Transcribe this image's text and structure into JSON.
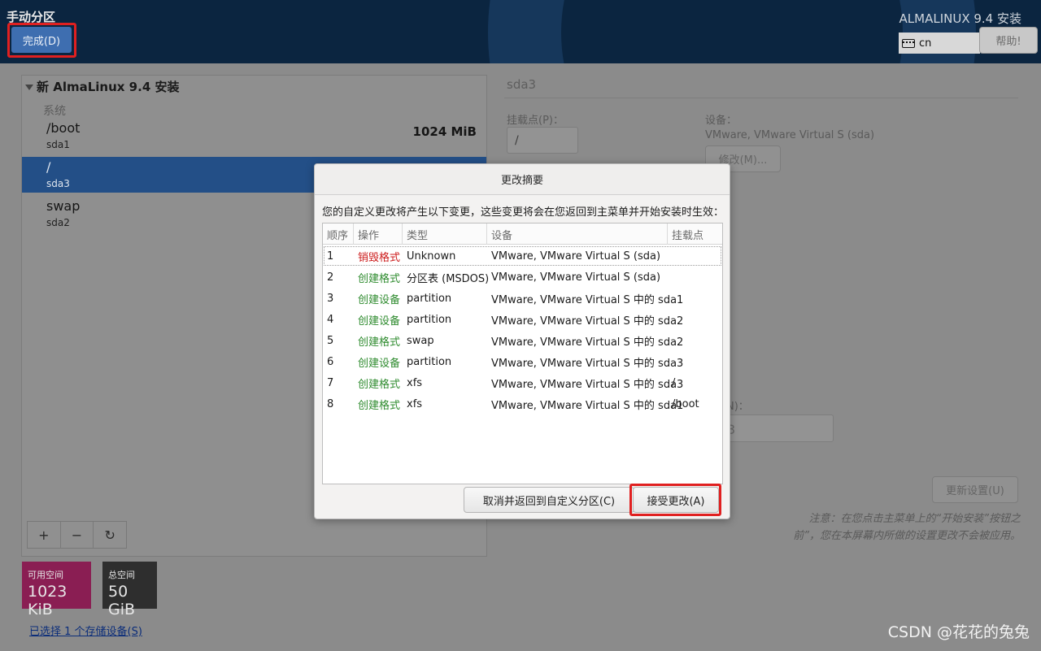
{
  "header": {
    "title": "手动分区",
    "done_label": "完成(D)",
    "product": "ALMALINUX 9.4 安装",
    "keyboard_layout": "cn",
    "help_label": "帮助!"
  },
  "left_panel": {
    "install_title": "新 AlmaLinux 9.4 安装",
    "section": "系统",
    "mounts": [
      {
        "name": "/boot",
        "device": "sda1",
        "size": "1024 MiB",
        "selected": false
      },
      {
        "name": "/",
        "device": "sda3",
        "size": "",
        "selected": true
      },
      {
        "name": "swap",
        "device": "sda2",
        "size": "",
        "selected": false
      }
    ],
    "tools": [
      "+",
      "−",
      "↻"
    ]
  },
  "space": {
    "available_label": "可用空间",
    "available_value": "1023 KiB",
    "total_label": "总空间",
    "total_value": "50 GiB"
  },
  "storage_link": "已选择 1 个存储设备(S)",
  "right_panel": {
    "title": "sda3",
    "mount_label": "挂载点(P)：",
    "mount_value": "/",
    "device_label": "设备：",
    "device_value": "VMware, VMware Virtual S (sda)",
    "modify_label": "修改(M)...",
    "partial_label": "N)：",
    "partial_value": "3",
    "update_label": "更新设置(U)",
    "note": "注意：在您点击主菜单上的“开始安装”按钮之前”，您在本屏幕内所做的设置更改不会被应用。"
  },
  "dialog": {
    "title": "更改摘要",
    "description": "您的自定义更改将产生以下变更，这些变更将会在您返回到主菜单并开始安装时生效：",
    "columns": [
      "顺序",
      "操作",
      "类型",
      "设备",
      "挂载点"
    ],
    "rows": [
      {
        "order": "1",
        "action": "销毁格式",
        "type": "Unknown",
        "device": "VMware, VMware Virtual S (sda)",
        "mount": "",
        "color": "#cc1a1a"
      },
      {
        "order": "2",
        "action": "创建格式",
        "type": "分区表 (MSDOS)",
        "device": "VMware, VMware Virtual S (sda)",
        "mount": "",
        "color": "#2e8b2e"
      },
      {
        "order": "3",
        "action": "创建设备",
        "type": "partition",
        "device": "VMware, VMware Virtual S 中的 sda1",
        "mount": "",
        "color": "#2e8b2e"
      },
      {
        "order": "4",
        "action": "创建设备",
        "type": "partition",
        "device": "VMware, VMware Virtual S 中的 sda2",
        "mount": "",
        "color": "#2e8b2e"
      },
      {
        "order": "5",
        "action": "创建格式",
        "type": "swap",
        "device": "VMware, VMware Virtual S 中的 sda2",
        "mount": "",
        "color": "#2e8b2e"
      },
      {
        "order": "6",
        "action": "创建设备",
        "type": "partition",
        "device": "VMware, VMware Virtual S 中的 sda3",
        "mount": "",
        "color": "#2e8b2e"
      },
      {
        "order": "7",
        "action": "创建格式",
        "type": "xfs",
        "device": "VMware, VMware Virtual S 中的 sda3",
        "mount": "/",
        "color": "#2e8b2e"
      },
      {
        "order": "8",
        "action": "创建格式",
        "type": "xfs",
        "device": "VMware, VMware Virtual S 中的 sda1",
        "mount": "/boot",
        "color": "#2e8b2e"
      }
    ],
    "cancel_label": "取消并返回到自定义分区(C)",
    "accept_label": "接受更改(A)"
  },
  "watermark": "CSDN @花花的兔兔"
}
